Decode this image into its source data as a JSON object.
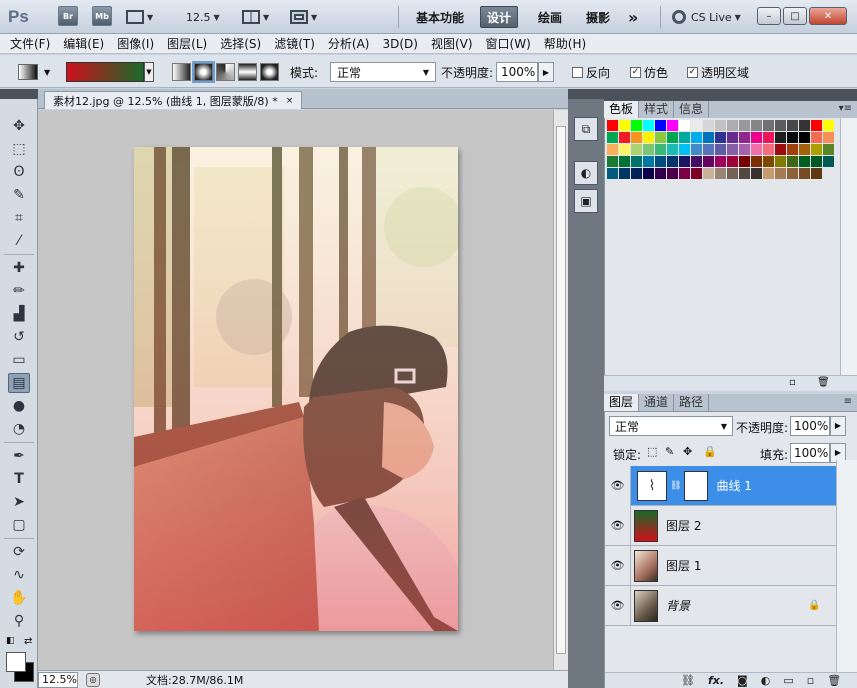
{
  "appbar": {
    "logo": "Ps",
    "bridge": "Br",
    "minibridge": "Mb",
    "zoom": "12.5",
    "workspaces": [
      {
        "label": "基本功能",
        "active": false
      },
      {
        "label": "设计",
        "active": true
      },
      {
        "label": "绘画",
        "active": false
      },
      {
        "label": "摄影",
        "active": false
      }
    ],
    "more": "»",
    "cslive": "CS Live",
    "win_min": "–",
    "win_max": "□",
    "win_close": "✕"
  },
  "menu": [
    "文件(F)",
    "编辑(E)",
    "图像(I)",
    "图层(L)",
    "选择(S)",
    "滤镜(T)",
    "分析(A)",
    "3D(D)",
    "视图(V)",
    "窗口(W)",
    "帮助(H)"
  ],
  "options": {
    "gradient_colors": [
      "#d0101c",
      "#1a6a2a"
    ],
    "mode_label": "模式:",
    "mode_value": "正常",
    "opacity_label": "不透明度:",
    "opacity_value": "100%",
    "reverse_label": "反向",
    "reverse_checked": false,
    "dither_label": "仿色",
    "dither_checked": true,
    "transparency_label": "透明区域",
    "transparency_checked": true
  },
  "document": {
    "tab_title": "素材12.jpg @ 12.5% (曲线 1, 图层蒙版/8) *",
    "close": "×",
    "zoom": "12.5%",
    "doc_size": "文档:28.7M/86.1M"
  },
  "tools": [
    {
      "name": "move-tool",
      "icon": "✥"
    },
    {
      "name": "marquee-tool",
      "icon": "⬚"
    },
    {
      "name": "lasso-tool",
      "icon": "ʘ"
    },
    {
      "name": "quick-select-tool",
      "icon": "✎"
    },
    {
      "name": "crop-tool",
      "icon": "⌗"
    },
    {
      "name": "eyedropper-tool",
      "icon": "⁄"
    },
    {
      "name": "healing-tool",
      "icon": "✚"
    },
    {
      "name": "brush-tool",
      "icon": "✏"
    },
    {
      "name": "stamp-tool",
      "icon": "▟"
    },
    {
      "name": "history-brush-tool",
      "icon": "↺"
    },
    {
      "name": "eraser-tool",
      "icon": "▭"
    },
    {
      "name": "gradient-tool",
      "icon": "▤"
    },
    {
      "name": "blur-tool",
      "icon": "●"
    },
    {
      "name": "dodge-tool",
      "icon": "◔"
    },
    {
      "name": "pen-tool",
      "icon": "✒"
    },
    {
      "name": "type-tool",
      "icon": "T"
    },
    {
      "name": "path-select-tool",
      "icon": "➤"
    },
    {
      "name": "shape-tool",
      "icon": "▢"
    },
    {
      "name": "3d-rotate-tool",
      "icon": "⟳"
    },
    {
      "name": "3d-orbit-tool",
      "icon": "∿"
    },
    {
      "name": "hand-tool",
      "icon": "✋"
    },
    {
      "name": "zoom-tool",
      "icon": "⚲"
    }
  ],
  "color_panel": {
    "tabs": [
      "色板",
      "样式",
      "信息"
    ],
    "swatches": [
      "#ff0000",
      "#ffff00",
      "#00ff00",
      "#00ffff",
      "#0000ff",
      "#ff00ff",
      "#ffffff",
      "#ebebeb",
      "#d6d6d6",
      "#c2c2c2",
      "#adadad",
      "#999999",
      "#858585",
      "#707070",
      "#5c5c5c",
      "#474747",
      "#333333",
      "#ff0000",
      "#ffff00",
      "#00a651",
      "#ee1d24",
      "#f7941d",
      "#fff200",
      "#8dc63f",
      "#00a651",
      "#00a99d",
      "#00aeef",
      "#0072bc",
      "#2e3192",
      "#662d91",
      "#92278f",
      "#ec008c",
      "#ed145b",
      "#1e1e1e",
      "#0a0a0a",
      "#000000",
      "#f26c4f",
      "#f68e55",
      "#fbaf5c",
      "#fff467",
      "#acd372",
      "#7cc576",
      "#3bb878",
      "#1abbb4",
      "#00bff3",
      "#438ccb",
      "#5574b9",
      "#605ca8",
      "#855fa8",
      "#a763a9",
      "#f06ea9",
      "#f26d7d",
      "#9e0b0f",
      "#a0410d",
      "#a36209",
      "#aba000",
      "#598527",
      "#197b30",
      "#007236",
      "#00746b",
      "#0076a3",
      "#004b80",
      "#003471",
      "#1b1464",
      "#440e62",
      "#630460",
      "#9e005d",
      "#9e0039",
      "#790000",
      "#7b2e00",
      "#7d4900",
      "#827b00",
      "#406618",
      "#005e20",
      "#005826",
      "#005952",
      "#005b7f",
      "#003663",
      "#002157",
      "#0d004c",
      "#32004b",
      "#4b0049",
      "#7b0046",
      "#7a0026",
      "#c7b299",
      "#998675",
      "#736357",
      "#534741",
      "#37302d",
      "#c69c6d",
      "#a67c52",
      "#8c6239",
      "#754c24",
      "#603913"
    ]
  },
  "layers_panel": {
    "tabs": [
      "图层",
      "通道",
      "路径"
    ],
    "blend_mode": "正常",
    "opacity_label": "不透明度:",
    "opacity_value": "100%",
    "lock_label": "锁定:",
    "fill_label": "填充:",
    "fill_value": "100%",
    "layers": [
      {
        "name": "曲线 1",
        "type": "curves",
        "selected": true
      },
      {
        "name": "图层 2",
        "type": "gradient",
        "selected": false
      },
      {
        "name": "图层 1",
        "type": "photo",
        "selected": false
      },
      {
        "name": "背景",
        "type": "photo",
        "selected": false,
        "locked": true
      }
    ],
    "footer_fx": "fx."
  }
}
